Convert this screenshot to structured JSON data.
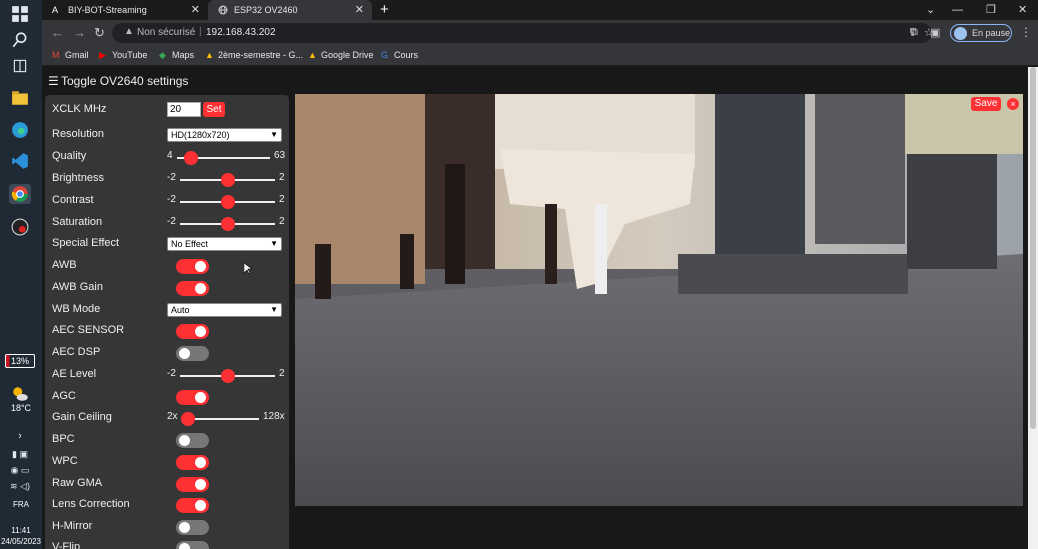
{
  "browser": {
    "tabs": [
      {
        "label": "BIY-BOT-Streaming",
        "favicon": "A",
        "active": false
      },
      {
        "label": "ESP32 OV2460",
        "favicon": "globe",
        "active": true
      }
    ],
    "address": {
      "security": "Non sécurisé",
      "host": "192.168.43.202"
    },
    "profile_status": "En pause",
    "bookmarks": [
      {
        "label": "Gmail",
        "icon": "gmail-icon",
        "color": "#ea4335"
      },
      {
        "label": "YouTube",
        "icon": "youtube-icon",
        "color": "#ff0000"
      },
      {
        "label": "Maps",
        "icon": "maps-icon",
        "color": "#34a853"
      },
      {
        "label": "2ème-semestre - G...",
        "icon": "drive-icon",
        "color": "#fbbc04"
      },
      {
        "label": "Google Drive",
        "icon": "drive-icon",
        "color": "#fbbc04"
      },
      {
        "label": "Cours",
        "icon": "google-icon",
        "color": "#4285f4"
      }
    ]
  },
  "taskbar": {
    "battery": "13%",
    "temperature": "18°C",
    "language": "FRA",
    "time": "11:41",
    "date": "24/05/2023"
  },
  "page": {
    "menu_title": "Toggle OV2640 settings",
    "xclk": {
      "label": "XCLK MHz",
      "value": "20",
      "button": "Set"
    },
    "resolution": {
      "label": "Resolution",
      "value": "HD(1280x720)"
    },
    "quality": {
      "label": "Quality",
      "min": "4",
      "max": "63",
      "value": 10,
      "lo": 4,
      "hi": 63
    },
    "brightness": {
      "label": "Brightness",
      "min": "-2",
      "max": "2",
      "value": 0,
      "lo": -2,
      "hi": 2
    },
    "contrast": {
      "label": "Contrast",
      "min": "-2",
      "max": "2",
      "value": 0,
      "lo": -2,
      "hi": 2
    },
    "saturation": {
      "label": "Saturation",
      "min": "-2",
      "max": "2",
      "value": 0,
      "lo": -2,
      "hi": 2
    },
    "special_effect": {
      "label": "Special Effect",
      "value": "No Effect"
    },
    "awb": {
      "label": "AWB",
      "on": true
    },
    "awb_gain": {
      "label": "AWB Gain",
      "on": true
    },
    "wb_mode": {
      "label": "WB Mode",
      "value": "Auto"
    },
    "aec_sensor": {
      "label": "AEC SENSOR",
      "on": true
    },
    "aec_dsp": {
      "label": "AEC DSP",
      "on": false
    },
    "ae_level": {
      "label": "AE Level",
      "min": "-2",
      "max": "2",
      "value": 0,
      "lo": -2,
      "hi": 2
    },
    "agc": {
      "label": "AGC",
      "on": true
    },
    "gain_ceiling": {
      "label": "Gain Ceiling",
      "min": "2x",
      "max": "128x",
      "value": 0,
      "lo": 0,
      "hi": 6
    },
    "bpc": {
      "label": "BPC",
      "on": false
    },
    "wpc": {
      "label": "WPC",
      "on": true
    },
    "raw_gma": {
      "label": "Raw GMA",
      "on": true
    },
    "lens_correction": {
      "label": "Lens Correction",
      "on": true
    },
    "h_mirror": {
      "label": "H-Mirror",
      "on": false
    },
    "v_flip": {
      "label": "V-Flip",
      "on": false
    },
    "stream": {
      "save_label": "Save",
      "close_label": "×"
    }
  },
  "colors": {
    "accent": "#ff3034",
    "panel": "#363636",
    "background": "#181818"
  }
}
